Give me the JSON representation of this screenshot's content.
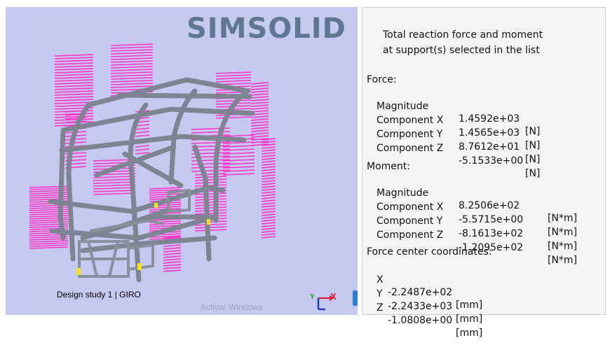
{
  "viewport": {
    "brand": "SIMSOLID",
    "caption": "Design study 1 | GIRO",
    "watermark": "Activar Windows",
    "triad": {
      "x_label": "X",
      "y_label": "Y"
    },
    "colors": {
      "background": "#c5c8ef",
      "frame": "#7f8492",
      "load_arrows": "#ff2fc8",
      "supports": "#f4e21c"
    }
  },
  "results": {
    "header_line1": "Total reaction force and moment",
    "header_line2": "at support(s) selected in the list",
    "force": {
      "title": "Force:",
      "rows": [
        {
          "label": "Magnitude",
          "value": "1.4592e+03",
          "unit": "[N]"
        },
        {
          "label": "Component X",
          "value": "1.4565e+03",
          "unit": "[N]"
        },
        {
          "label": "Component Y",
          "value": "8.7612e+01",
          "unit": "[N]"
        },
        {
          "label": "Component Z",
          "value": "-5.1533e+00",
          "unit": "[N]"
        }
      ]
    },
    "moment": {
      "title": "Moment:",
      "rows": [
        {
          "label": "Magnitude",
          "value": "8.2506e+02",
          "unit": "[N*m]"
        },
        {
          "label": "Component X",
          "value": "-5.5715e+00",
          "unit": "[N*m]"
        },
        {
          "label": "Component Y",
          "value": "-8.1613e+02",
          "unit": "[N*m]"
        },
        {
          "label": "Component Z",
          "value": "-1.2095e+02",
          "unit": "[N*m]"
        }
      ]
    },
    "center": {
      "title": "Force center coordinates:",
      "rows": [
        {
          "label": "X",
          "value": "-2.2487e+02",
          "unit": "[mm]"
        },
        {
          "label": "Y",
          "value": "-2.2433e+03",
          "unit": "[mm]"
        },
        {
          "label": "Z",
          "value": "-1.0808e+00",
          "unit": "[mm]"
        }
      ]
    }
  }
}
